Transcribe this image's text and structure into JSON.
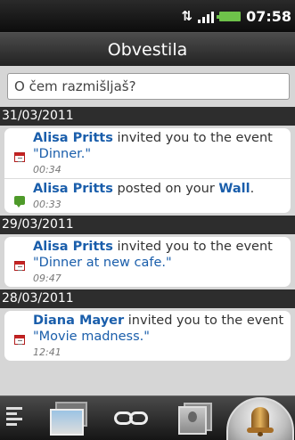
{
  "status_bar": {
    "time": "07:58",
    "usb_icon": "usb-debug-icon",
    "signal_icon": "signal-icon",
    "battery_icon": "battery-icon"
  },
  "header": {
    "title": "Obvestila"
  },
  "composer": {
    "placeholder": "O čem razmišljaš?"
  },
  "feed": {
    "groups": [
      {
        "date": "31/03/2011",
        "entries": [
          {
            "icon": "calendar-icon",
            "actor": "Alisa Pritts",
            "text": " invited you to the event ",
            "open_quote": "\"",
            "target": "Dinner",
            "close_quote": ".\"",
            "time": "00:34"
          },
          {
            "icon": "wall-post-icon",
            "actor": "Alisa Pritts",
            "text": " posted on your ",
            "target": "Wall",
            "close": ".",
            "time": "00:33"
          }
        ]
      },
      {
        "date": "29/03/2011",
        "entries": [
          {
            "icon": "calendar-icon",
            "actor": "Alisa Pritts",
            "text": " invited you to the event ",
            "open_quote": "\"",
            "target": "Dinner at new cafe",
            "close_quote": ".\"",
            "time": "09:47"
          }
        ]
      },
      {
        "date": "28/03/2011",
        "entries": [
          {
            "icon": "calendar-icon",
            "actor": "Diana Mayer",
            "text": " invited you to the event ",
            "open_quote": "\"",
            "target": "Movie madness",
            "close_quote": ".\"",
            "time": "12:41"
          }
        ]
      }
    ]
  },
  "tabs": [
    {
      "icon": "notes-icon",
      "active": false
    },
    {
      "icon": "photos-icon",
      "active": false
    },
    {
      "icon": "links-icon",
      "active": false
    },
    {
      "icon": "people-icon",
      "active": false
    },
    {
      "icon": "bell-icon",
      "active": true
    }
  ],
  "colors": {
    "link_blue": "#1a5eab",
    "header_dark": "#2d2d2d",
    "feed_background": "#d6d6d6"
  }
}
